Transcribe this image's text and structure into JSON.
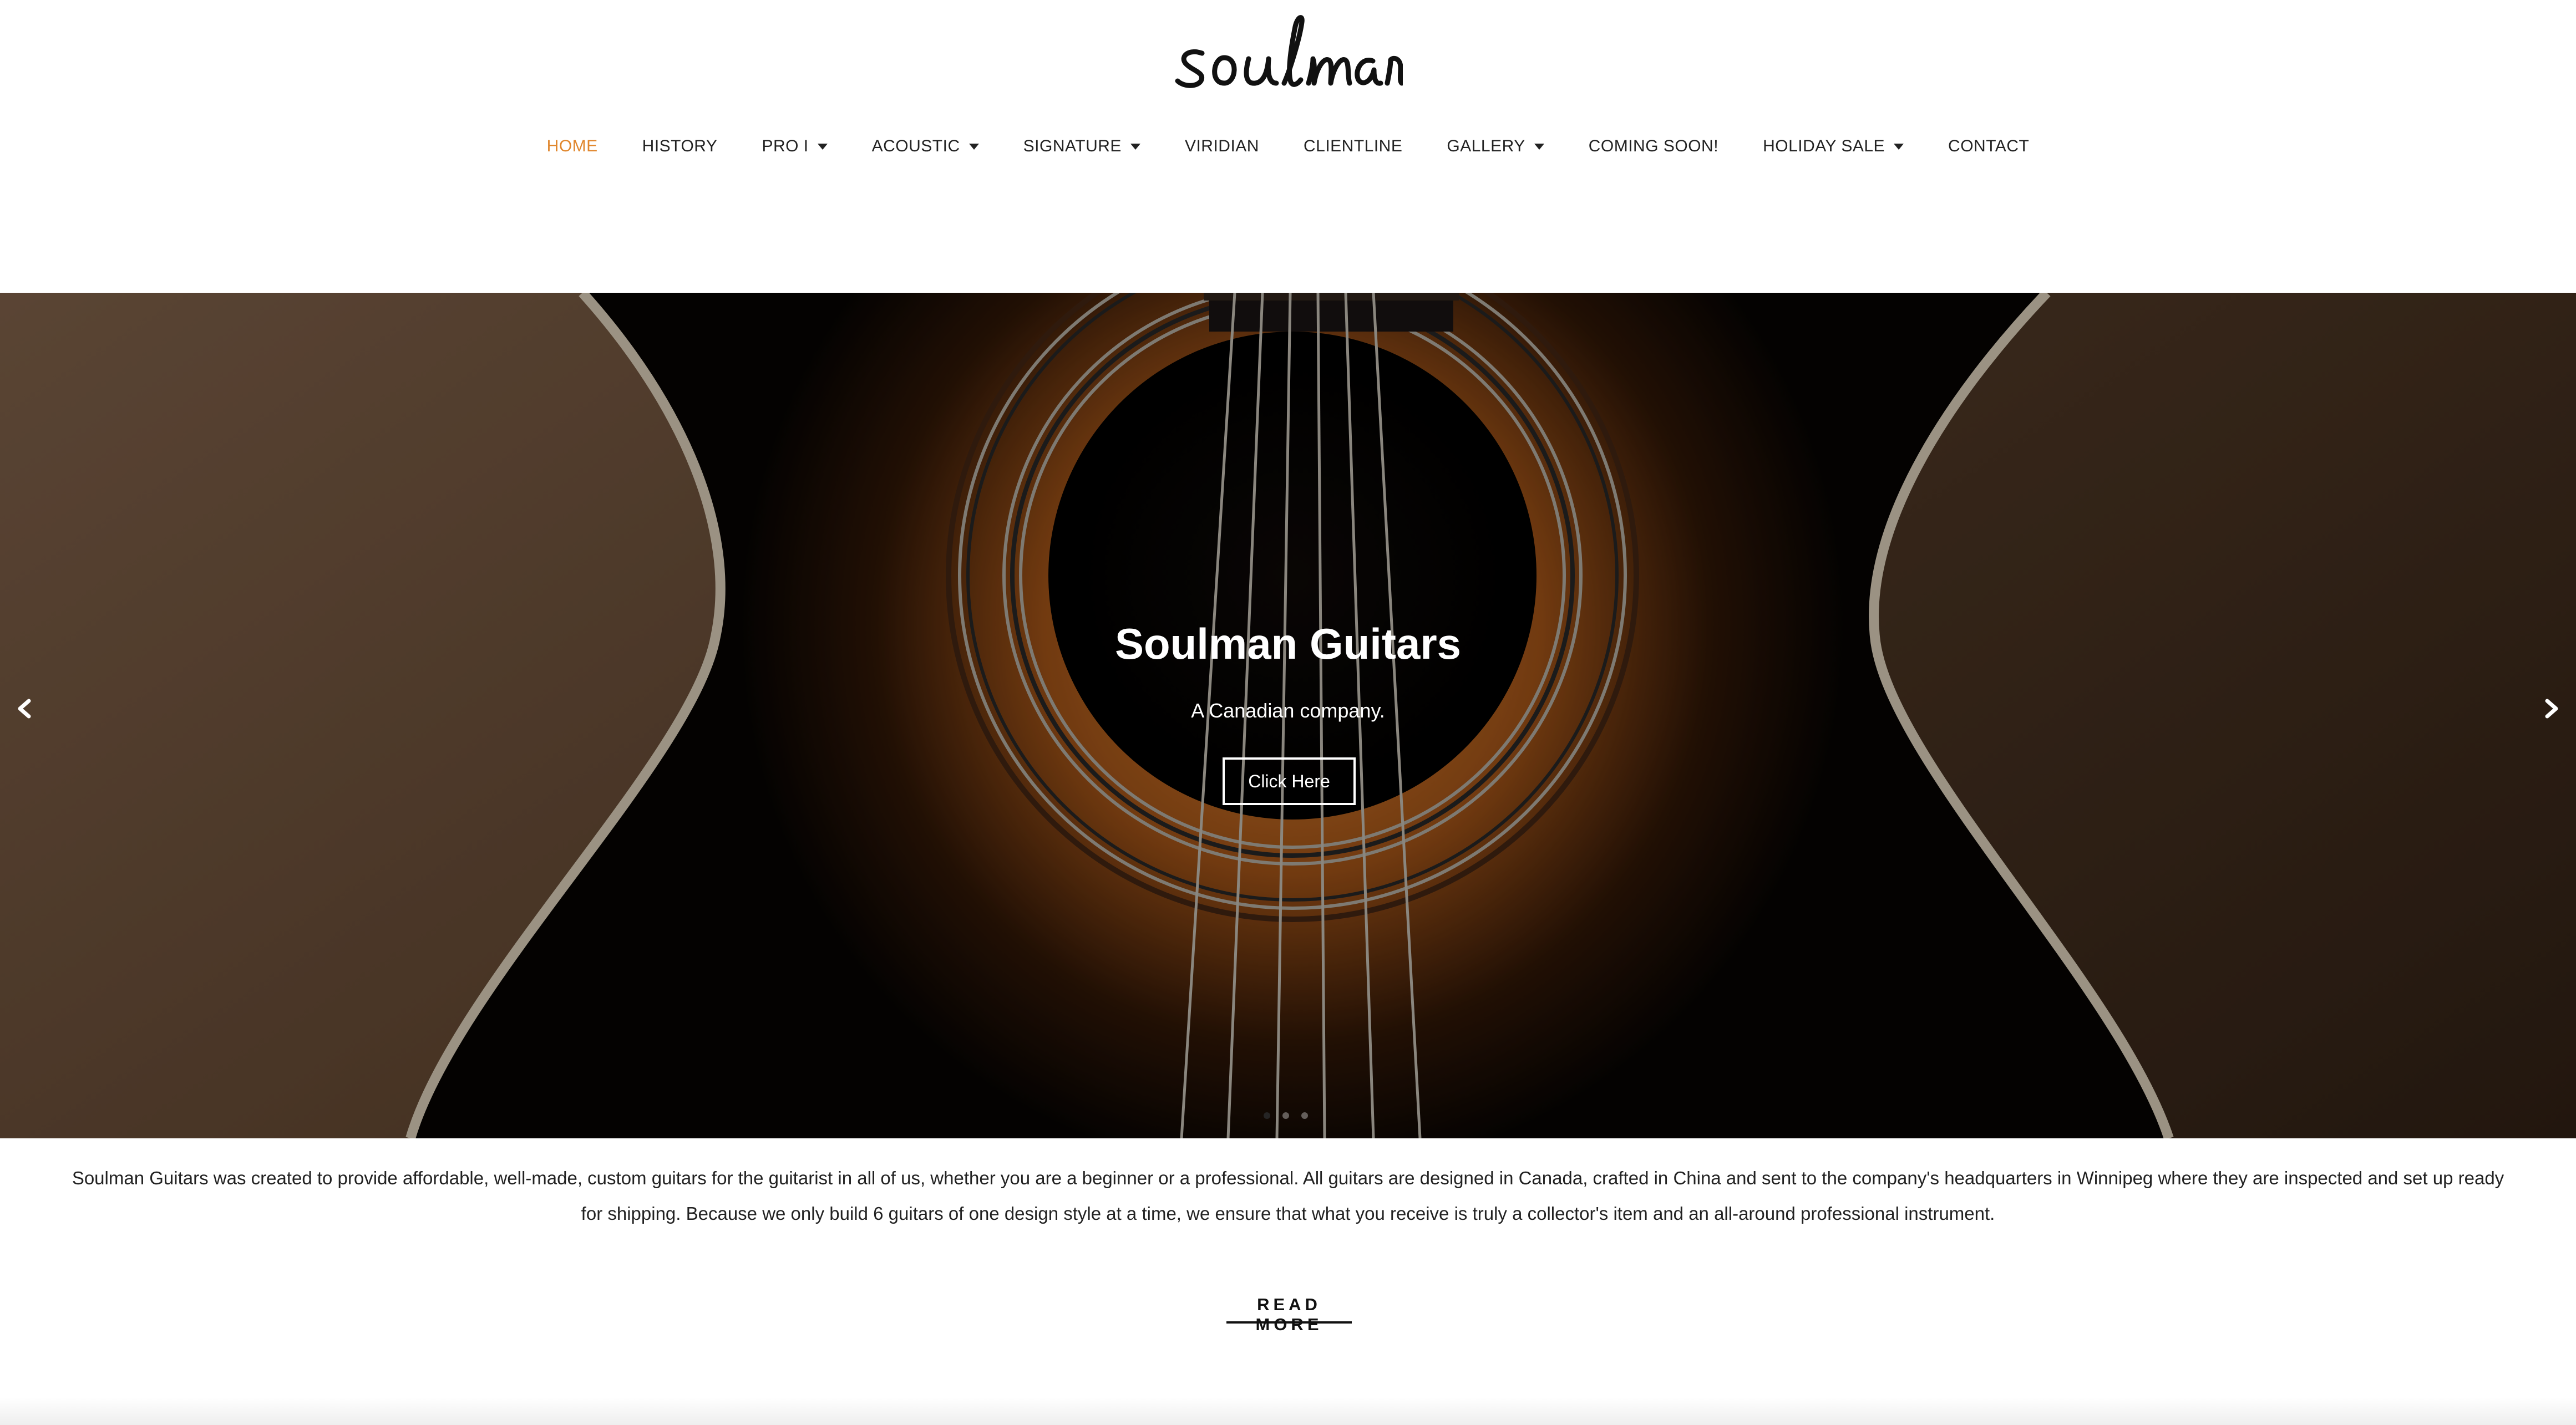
{
  "brand": {
    "logo_text": "soulman"
  },
  "nav": {
    "items": [
      {
        "label": "HOME",
        "active": true,
        "dropdown": false
      },
      {
        "label": "HISTORY",
        "active": false,
        "dropdown": false
      },
      {
        "label": "PRO I",
        "active": false,
        "dropdown": true
      },
      {
        "label": "ACOUSTIC",
        "active": false,
        "dropdown": true
      },
      {
        "label": "SIGNATURE",
        "active": false,
        "dropdown": true
      },
      {
        "label": "VIRIDIAN",
        "active": false,
        "dropdown": false
      },
      {
        "label": "CLIENTLINE",
        "active": false,
        "dropdown": false
      },
      {
        "label": "GALLERY",
        "active": false,
        "dropdown": true
      },
      {
        "label": "COMING SOON!",
        "active": false,
        "dropdown": false
      },
      {
        "label": "HOLIDAY SALE",
        "active": false,
        "dropdown": true
      },
      {
        "label": "CONTACT",
        "active": false,
        "dropdown": false
      }
    ],
    "active_color": "#e0862c"
  },
  "hero": {
    "title": "Soulman Guitars",
    "subtitle": "A Canadian company.",
    "button_label": "Click Here",
    "prev_icon": "chevron-left-icon",
    "next_icon": "chevron-right-icon",
    "slide_count": 3,
    "active_slide": 1
  },
  "intro": {
    "text": "Soulman Guitars was created to provide affordable, well-made, custom guitars for the guitarist in all of us, whether you are a beginner or a professional.  All guitars are designed in Canada, crafted in China and sent to the company's headquarters in Winnipeg where they are inspected and set up ready for shipping. Because we only build 6 guitars of one design style at a time, we ensure that what you receive is truly a collector's item and an all-around professional instrument."
  },
  "read_more": {
    "label": "READ MORE"
  }
}
